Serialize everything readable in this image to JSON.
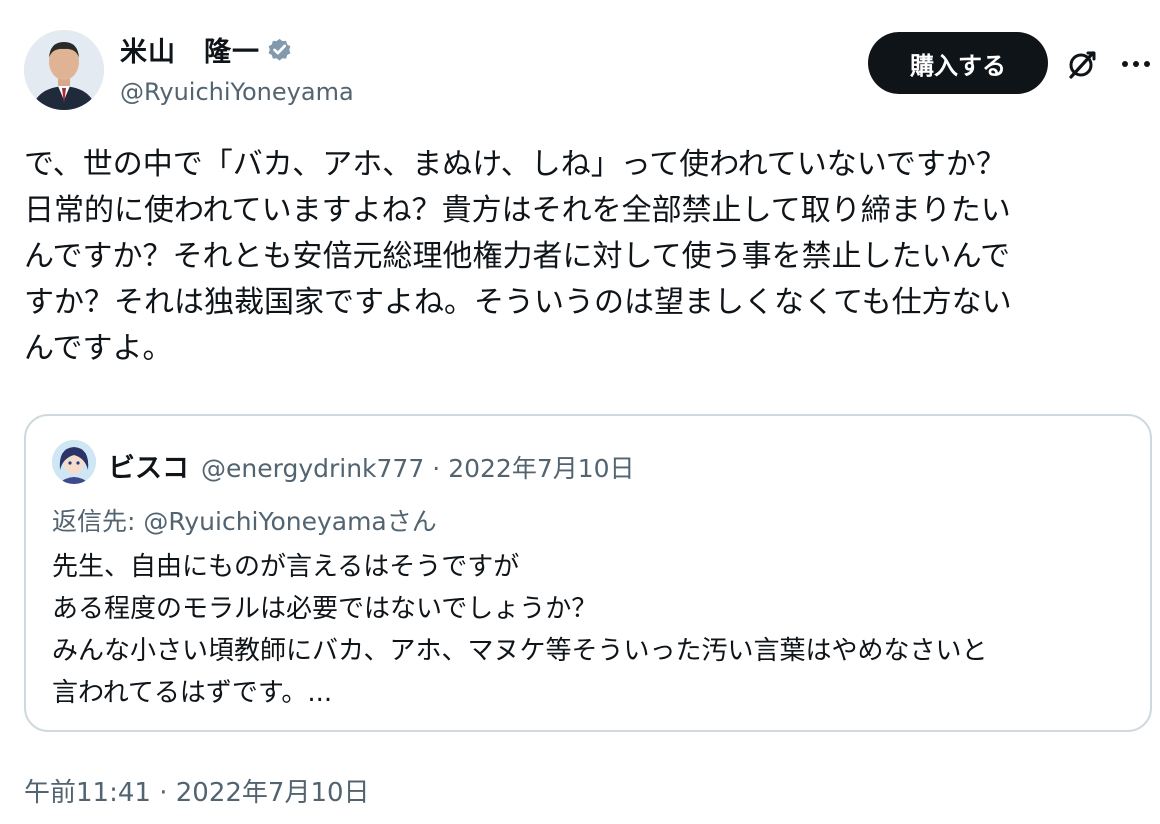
{
  "author": {
    "display_name": "米山　隆一",
    "handle": "@RyuichiYoneyama",
    "avatar_icon": "user-avatar-photo",
    "verified_icon": "verified-badge-icon",
    "verified_color": "#829aab"
  },
  "actions": {
    "buy_label": "購入する",
    "grok_icon": "grok-icon",
    "more_icon": "more-icon"
  },
  "tweet": {
    "lines": [
      "で、世の中で「バカ、アホ、まぬけ、しね」って使われていないですか？",
      "日常的に使われていますよね？貴方はそれを全部禁止して取り締まりたい",
      "んですか？それとも安倍元総理他権力者に対して使う事を禁止したいんで",
      "すか？それは独裁国家ですよね。そういうのは望ましくなくても仕方ない",
      "んですよ。"
    ]
  },
  "quote": {
    "name": "ビスコ",
    "handle": "@energydrink777",
    "separator": "·",
    "date": "2022年7月10日",
    "reply_to": "返信先: @RyuichiYoneyamaさん",
    "avatar_icon": "anime-avatar",
    "lines": [
      "先生、自由にものが言えるはそうですが",
      "ある程度のモラルは必要ではないでしょうか？",
      "みんな小さい頃教師にバカ、アホ、マヌケ等そういった汚い言葉はやめなさいと",
      "言われてるはずです。..."
    ]
  },
  "timestamp": {
    "time": "午前11:41",
    "separator": " · ",
    "date": "2022年7月10日"
  },
  "colors": {
    "text": "#0f1419",
    "secondary": "#536471",
    "border": "#cfd9de",
    "button_bg": "#0f1419"
  }
}
